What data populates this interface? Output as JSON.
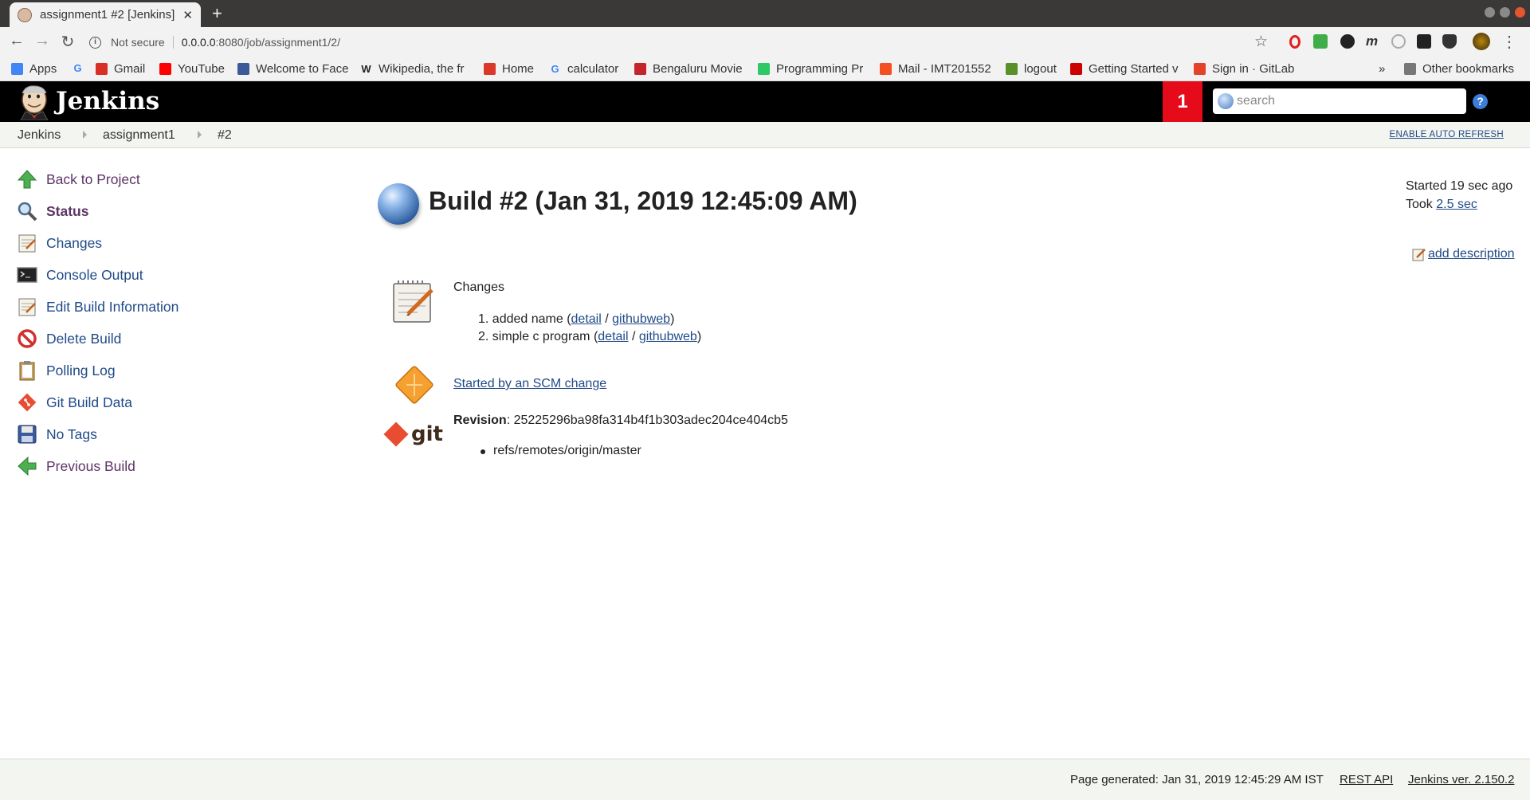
{
  "browser": {
    "tab_title": "assignment1 #2 [Jenkins]",
    "security_label": "Not secure",
    "url_host": "0.0.0.0",
    "url_rest": ":8080/job/assignment1/2/",
    "bookmarks": [
      {
        "label": "Apps",
        "icon": "apps-grid-icon",
        "color": "#4285f4"
      },
      {
        "label": "",
        "icon": "google-icon",
        "color": "#4285f4"
      },
      {
        "label": "Gmail",
        "icon": "gmail-icon",
        "color": "#d93025"
      },
      {
        "label": "YouTube",
        "icon": "youtube-icon",
        "color": "#ff0000"
      },
      {
        "label": "Welcome to Face",
        "icon": "facebook-icon",
        "color": "#3b5998"
      },
      {
        "label": "Wikipedia, the fr",
        "icon": "wikipedia-icon",
        "color": "#222222"
      },
      {
        "label": "Home",
        "icon": "home-site-icon",
        "color": "#d9382b"
      },
      {
        "label": "calculator",
        "icon": "google-icon",
        "color": "#4285f4"
      },
      {
        "label": "Bengaluru Movie",
        "icon": "bookmyshow-icon",
        "color": "#c4242b"
      },
      {
        "label": "Programming Pr",
        "icon": "hackerrank-icon",
        "color": "#2ec866"
      },
      {
        "label": "Mail - IMT201552",
        "icon": "microsoft-icon",
        "color": "#f25022"
      },
      {
        "label": "logout",
        "icon": "logout-site-icon",
        "color": "#5a8f29"
      },
      {
        "label": "Getting Started v",
        "icon": "redhat-icon",
        "color": "#cc0000"
      },
      {
        "label": "Sign in · GitLab",
        "icon": "gitlab-icon",
        "color": "#e24329"
      }
    ],
    "overflow_label": "»",
    "other_bookmarks": "Other bookmarks"
  },
  "jenkins": {
    "brand": "Jenkins",
    "notification_count": "1",
    "search_placeholder": "search",
    "help": "?",
    "breadcrumbs": [
      "Jenkins",
      "assignment1",
      "#2"
    ],
    "auto_refresh": "ENABLE AUTO REFRESH"
  },
  "sidebar": [
    {
      "label": "Back to Project",
      "icon": "up-arrow-icon"
    },
    {
      "label": "Status",
      "icon": "magnifier-icon"
    },
    {
      "label": "Changes",
      "icon": "notepad-icon"
    },
    {
      "label": "Console Output",
      "icon": "terminal-icon"
    },
    {
      "label": "Edit Build Information",
      "icon": "notepad-icon"
    },
    {
      "label": "Delete Build",
      "icon": "no-entry-icon"
    },
    {
      "label": "Polling Log",
      "icon": "clipboard-icon"
    },
    {
      "label": "Git Build Data",
      "icon": "git-icon"
    },
    {
      "label": "No Tags",
      "icon": "floppy-disk-icon"
    },
    {
      "label": "Previous Build",
      "icon": "left-arrow-icon"
    }
  ],
  "build": {
    "title": "Build #2 (Jan 31, 2019 12:45:09 AM)",
    "started": "Started 19 sec ago",
    "took_prefix": "Took ",
    "took_value": "2.5 sec",
    "add_description": "add description",
    "changes_title": "Changes",
    "changes": [
      {
        "num": "1.",
        "text": "added name (",
        "detail": "detail",
        "slash": " / ",
        "githubweb": "githubweb",
        "close": ")"
      },
      {
        "num": "2.",
        "text": "simple c program (",
        "detail": "detail",
        "slash": " / ",
        "githubweb": "githubweb",
        "close": ")"
      }
    ],
    "scm_cause": "Started by an SCM change",
    "git_word": "git",
    "revision_label": "Revision",
    "revision_value": ": 25225296ba98fa314b4f1b303adec204ce404cb5",
    "ref": "refs/remotes/origin/master"
  },
  "footer": {
    "generated": "Page generated: Jan 31, 2019 12:45:29 AM IST",
    "rest_api": "REST API",
    "version": "Jenkins ver. 2.150.2"
  }
}
